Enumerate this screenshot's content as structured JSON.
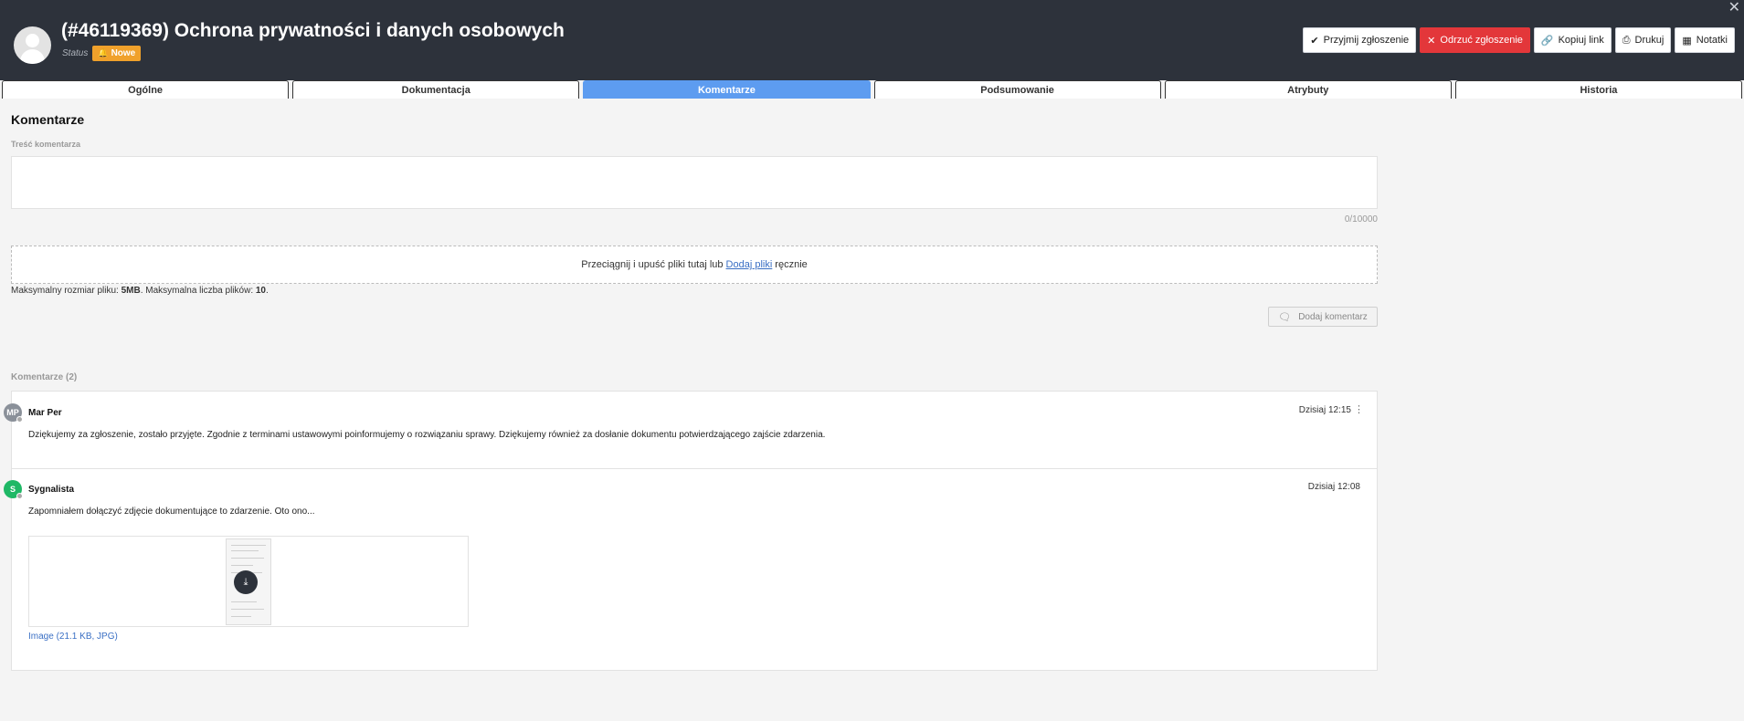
{
  "header": {
    "title": "(#46119369) Ochrona prywatności i danych osobowych",
    "status_label": "Status",
    "status_badge": "Nowe",
    "close": "✕",
    "actions": {
      "accept": "Przyjmij zgłoszenie",
      "reject": "Odrzuć zgłoszenie",
      "copy_link": "Kopiuj link",
      "print": "Drukuj",
      "notes": "Notatki"
    }
  },
  "tabs": [
    "Ogólne",
    "Dokumentacja",
    "Komentarze",
    "Podsumowanie",
    "Atrybuty",
    "Historia"
  ],
  "active_tab": "Komentarze",
  "main": {
    "section_title": "Komentarze",
    "comment_label": "Treść komentarza",
    "comment_value": "",
    "counter": "0/10000",
    "dropzone": {
      "before": "Przeciągnij i upuść pliki tutaj lub",
      "link": "Dodaj pliki",
      "after": "ręcznie"
    },
    "limits": {
      "size_label": "Maksymalny rozmiar pliku:",
      "size_value": "5MB",
      "count_label": ". Maksymalna liczba plików:",
      "count_value": "10",
      "end": "."
    },
    "add_button": "Dodaj komentarz",
    "comments_count": "Komentarze (2)"
  },
  "comments": [
    {
      "initials": "MP",
      "author": "Mar Per",
      "time": "Dzisiaj 12:15",
      "text": "Dziękujemy za zgłoszenie, zostało przyjęte. Zgodnie z terminami ustawowymi poinformujemy o rozwiązaniu sprawy. Dziękujemy również za dosłanie dokumentu potwierdzającego zajście zdarzenia."
    },
    {
      "initials": "S",
      "author": "Sygnalista",
      "time": "Dzisiaj 12:08",
      "text": "Zapomniałem dołączyć zdjęcie dokumentujące to zdarzenie. Oto ono...",
      "attachment": "Image (21.1 KB, JPG)"
    }
  ],
  "colors": {
    "header_bg": "#2d323b",
    "active_tab": "#5d9cf0",
    "danger": "#e3373a",
    "badge": "#f0a12b",
    "link": "#3a6fc4"
  }
}
